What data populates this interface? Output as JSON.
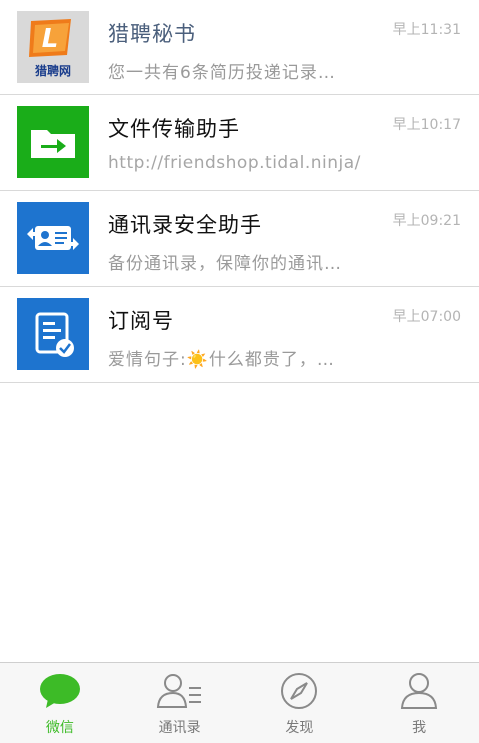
{
  "chats": [
    {
      "title": "猎聘秘书",
      "time": "早上11:31",
      "preview": "您一共有6条简历投递记录…",
      "avatar_text": "猎聘网"
    },
    {
      "title": "文件传输助手",
      "time": "早上10:17",
      "preview": "http://friendshop.tidal.ninja/"
    },
    {
      "title": "通讯录安全助手",
      "time": "早上09:21",
      "preview": "备份通讯录，保障你的通讯…"
    },
    {
      "title": "订阅号",
      "time": "早上07:00",
      "preview": "爱情句子:☀️什么都贵了，…"
    }
  ],
  "tabs": [
    {
      "label": "微信",
      "icon": "chat-bubble-icon",
      "active": true
    },
    {
      "label": "通讯录",
      "icon": "contacts-icon",
      "active": false
    },
    {
      "label": "发现",
      "icon": "compass-icon",
      "active": false
    },
    {
      "label": "我",
      "icon": "person-icon",
      "active": false
    }
  ],
  "colors": {
    "accent_green": "#3dbb27",
    "file_green": "#1aad19",
    "blue": "#1e74cf"
  }
}
